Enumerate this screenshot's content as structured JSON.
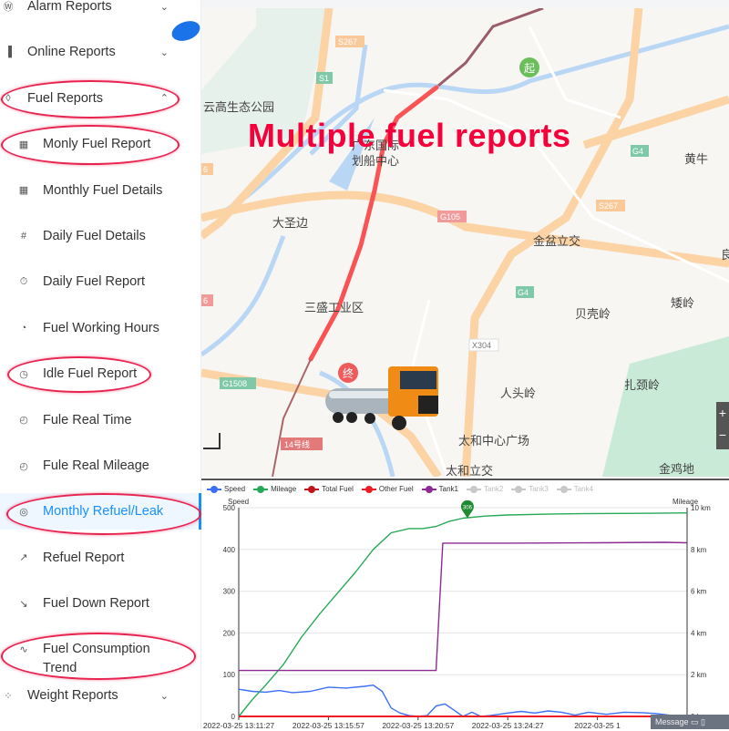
{
  "sidebar": {
    "items": [
      {
        "label": "Alarm Reports",
        "icon": "wordpress-icon",
        "glyph": "Ⓦ",
        "chevron": "⌄",
        "level": "top"
      },
      {
        "label": "Online Reports",
        "icon": "bar-chart-icon",
        "glyph": "▐",
        "chevron": "⌄",
        "level": "top"
      },
      {
        "label": "Fuel Reports",
        "icon": "fuel-icon",
        "glyph": "◊",
        "chevron": "⌃",
        "level": "top"
      },
      {
        "label": "Monly Fuel Report",
        "icon": "table-icon",
        "glyph": "▦",
        "level": "sub"
      },
      {
        "label": "Monthly Fuel Details",
        "icon": "grid-icon",
        "glyph": "▦",
        "level": "sub"
      },
      {
        "label": "Daily Fuel Details",
        "icon": "hash-icon",
        "glyph": "#",
        "level": "sub"
      },
      {
        "label": "Daily Fuel Report",
        "icon": "stopwatch-icon",
        "glyph": "⏱",
        "level": "sub"
      },
      {
        "label": "Fuel Working Hours",
        "icon": "clock-icon",
        "glyph": "◔",
        "level": "sub"
      },
      {
        "label": "Idle Fuel Report",
        "icon": "dashboard-icon",
        "glyph": "◷",
        "level": "sub"
      },
      {
        "label": "Fule Real Time",
        "icon": "timer-icon",
        "glyph": "◴",
        "level": "sub"
      },
      {
        "label": "Fule Real Mileage",
        "icon": "timer-icon",
        "glyph": "◴",
        "level": "sub"
      },
      {
        "label": "Monthly Refuel/Leak",
        "icon": "pie-chart-icon",
        "glyph": "◎",
        "level": "sub",
        "active": true
      },
      {
        "label": "Refuel Report",
        "icon": "line-up-icon",
        "glyph": "↗",
        "level": "sub"
      },
      {
        "label": "Fuel Down Report",
        "icon": "line-down-icon",
        "glyph": "↘",
        "level": "sub"
      },
      {
        "label": "Fuel Consumption Trend",
        "icon": "pulse-icon",
        "glyph": "∿",
        "level": "sub"
      },
      {
        "label": "Weight Reports",
        "icon": "weight-icon",
        "glyph": "⁘",
        "chevron": "⌄",
        "level": "top"
      }
    ]
  },
  "overlay_title": "Multiple fuel reports",
  "map": {
    "labels": [
      "云高生态公园",
      "广东国际",
      "划船中心",
      "大圣边",
      "金盆立交",
      "黄牛",
      "三盛工业区",
      "贝壳岭",
      "矮岭",
      "人头岭",
      "扎颈岭",
      "太和中心广场",
      "太和立交",
      "金鸡地",
      "良"
    ],
    "road_shields": [
      "S267",
      "S1",
      "G4",
      "S267",
      "G105",
      "G4",
      "X304",
      "G1508",
      "14号线",
      "6",
      "6"
    ],
    "start_marker": "起",
    "end_marker": "终"
  },
  "message_bar": {
    "label": "Message"
  },
  "colors": {
    "speed": "#3b6ff5",
    "mileage": "#27a957",
    "total_fuel": "#c0141c",
    "other_fuel": "#ee1c24",
    "tank1": "#8e2a94",
    "disabled": "#c8c8c8",
    "accent": "#1890ff"
  },
  "chart_data": {
    "type": "line",
    "legend": [
      "Speed",
      "Mileage",
      "Total Fuel",
      "Other Fuel",
      "Tank1",
      "Tank2",
      "Tank3",
      "Tank4"
    ],
    "legend_disabled": [
      "Tank2",
      "Tank3",
      "Tank4"
    ],
    "ylabel_left": "Speed",
    "ylabel_right": "Mileage",
    "yleft_ticks": [
      "0",
      "100",
      "200",
      "300",
      "400",
      "500"
    ],
    "yright_ticks": [
      "0 km",
      "2 km",
      "4 km",
      "6 km",
      "8 km",
      "10 km"
    ],
    "ylim_left": [
      0,
      500
    ],
    "ylim_right": [
      0,
      10
    ],
    "x_range": [
      0,
      100
    ],
    "x_ticks": [
      {
        "x": 0,
        "label": "2022-03-25 13:11:27"
      },
      {
        "x": 20,
        "label": "2022-03-25 13:15:57"
      },
      {
        "x": 40,
        "label": "2022-03-25 13:20:57"
      },
      {
        "x": 60,
        "label": "2022-03-25 13:24:27"
      },
      {
        "x": 80,
        "label": "2022-03-25 1"
      }
    ],
    "series": [
      {
        "name": "Speed",
        "axis": "left",
        "x": [
          0,
          3,
          6,
          9,
          12,
          16,
          20,
          24,
          28,
          30,
          32,
          34,
          36,
          38,
          40,
          42,
          44,
          46,
          48,
          50,
          52,
          54,
          56,
          58,
          60,
          63,
          66,
          69,
          72,
          75,
          78,
          82,
          86,
          90,
          93,
          96,
          100
        ],
        "values": [
          65,
          60,
          58,
          62,
          57,
          60,
          70,
          68,
          72,
          75,
          60,
          20,
          8,
          2,
          0,
          2,
          25,
          30,
          15,
          0,
          10,
          0,
          2,
          5,
          8,
          12,
          8,
          13,
          10,
          3,
          10,
          5,
          10,
          9,
          7,
          3,
          0
        ]
      },
      {
        "name": "Mileage",
        "axis": "right",
        "x": [
          0,
          3,
          6,
          10,
          14,
          18,
          22,
          26,
          30,
          34,
          38,
          41,
          44,
          47,
          50,
          55,
          60,
          70,
          80,
          90,
          100
        ],
        "values": [
          0,
          0.8,
          1.5,
          2.5,
          3.8,
          4.9,
          5.9,
          6.9,
          8.0,
          8.8,
          9.0,
          9.0,
          9.1,
          9.35,
          9.5,
          9.6,
          9.65,
          9.7,
          9.72,
          9.73,
          9.75
        ]
      },
      {
        "name": "Total Fuel",
        "axis": "left",
        "x": [
          0,
          100
        ],
        "values": [
          0,
          0
        ]
      },
      {
        "name": "Other Fuel",
        "axis": "left",
        "x": [
          0,
          100
        ],
        "values": [
          0,
          0
        ]
      },
      {
        "name": "Tank1",
        "axis": "left",
        "x": [
          0,
          44,
          45.5,
          60,
          80,
          95,
          100
        ],
        "values": [
          110,
          110,
          415,
          415,
          416,
          417,
          416
        ]
      }
    ],
    "annotations": [
      {
        "series": "Mileage",
        "x": 51,
        "value": 9.5,
        "label": "306"
      }
    ]
  }
}
